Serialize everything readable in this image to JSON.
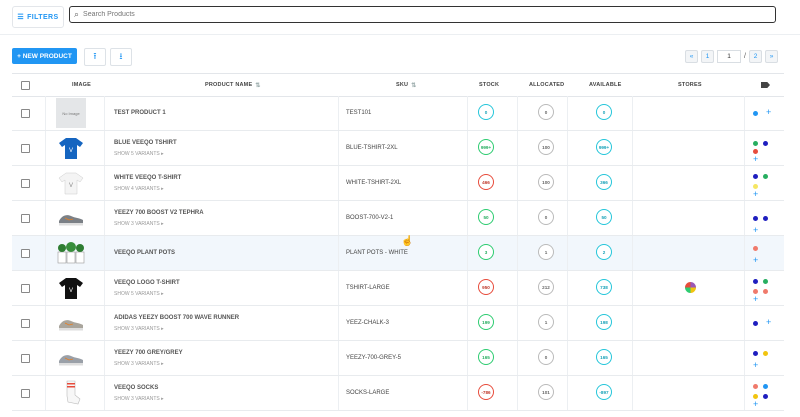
{
  "toolbar": {
    "filters_label": "FILTERS",
    "search_placeholder": "Search Products",
    "new_product_label": "+ NEW PRODUCT",
    "upload_icon": "upload-icon",
    "download_icon": "download-icon"
  },
  "pagination": {
    "first": "«",
    "prev_page": "1",
    "current": "1",
    "separator": "/",
    "total": "2",
    "last": "»"
  },
  "columns": {
    "image": "IMAGE",
    "product_name": "PRODUCT NAME",
    "sku": "SKU",
    "stock": "STOCK",
    "allocated": "ALLOCATED",
    "available": "AVAILABLE",
    "stores": "STORES"
  },
  "no_image_text": "No Image",
  "products": [
    {
      "name": "TEST PRODUCT 1",
      "variants": "",
      "sku": "TEST101",
      "stock": "0",
      "allocated": "0",
      "available": "0",
      "stock_color": "teal",
      "avail_color": "teal",
      "image": "no-image"
    },
    {
      "name": "BLUE VEEQO TSHIRT",
      "variants": "SHOW 5 VARIANTS ▸",
      "sku": "BLUE-TSHIRT-2XL",
      "stock": "999+",
      "allocated": "100",
      "available": "999+",
      "stock_color": "green",
      "avail_color": "teal",
      "image": "blue-tshirt"
    },
    {
      "name": "WHITE VEEQO T-SHIRT",
      "variants": "SHOW 4 VARIANTS ▸",
      "sku": "WHITE-TSHIRT-2XL",
      "stock": "466",
      "allocated": "100",
      "available": "366",
      "stock_color": "red",
      "avail_color": "teal",
      "image": "white-tshirt"
    },
    {
      "name": "YEEZY 700 BOOST V2 TEPHRA",
      "variants": "SHOW 3 VARIANTS ▸",
      "sku": "BOOST-700-V2-1",
      "stock": "50",
      "allocated": "0",
      "available": "50",
      "stock_color": "green",
      "avail_color": "teal",
      "image": "sneaker-grey"
    },
    {
      "name": "VEEQO PLANT POTS",
      "variants": "",
      "sku": "PLANT POTS - WHITE",
      "stock": "3",
      "allocated": "1",
      "available": "2",
      "stock_color": "green",
      "avail_color": "teal",
      "image": "plant-pots"
    },
    {
      "name": "VEEQO LOGO T-SHIRT",
      "variants": "SHOW 5 VARIANTS ▸",
      "sku": "TSHIRT-LARGE",
      "stock": "950",
      "allocated": "212",
      "available": "738",
      "stock_color": "red",
      "avail_color": "teal",
      "image": "black-tshirt"
    },
    {
      "name": "ADIDAS YEEZY BOOST 700 WAVE RUNNER",
      "variants": "SHOW 3 VARIANTS ▸",
      "sku": "YEEZ-CHALK-3",
      "stock": "199",
      "allocated": "1",
      "available": "198",
      "stock_color": "green",
      "avail_color": "teal",
      "image": "sneaker-wave"
    },
    {
      "name": "YEEZY 700 GREY/GREY",
      "variants": "SHOW 3 VARIANTS ▸",
      "sku": "YEEZY-700-GREY-5",
      "stock": "165",
      "allocated": "0",
      "available": "165",
      "stock_color": "green",
      "avail_color": "teal",
      "image": "sneaker-greygrey"
    },
    {
      "name": "VEEQO SOCKS",
      "variants": "SHOW 3 VARIANTS ▸",
      "sku": "SOCKS-LARGE",
      "stock": "-786",
      "allocated": "101",
      "available": "-897",
      "stock_color": "red",
      "avail_color": "teal",
      "image": "socks"
    }
  ],
  "colors": {
    "accent": "#2196f3",
    "stock_green": "#2ecc71",
    "stock_red": "#e74c3c",
    "available_teal": "#26c6da"
  }
}
